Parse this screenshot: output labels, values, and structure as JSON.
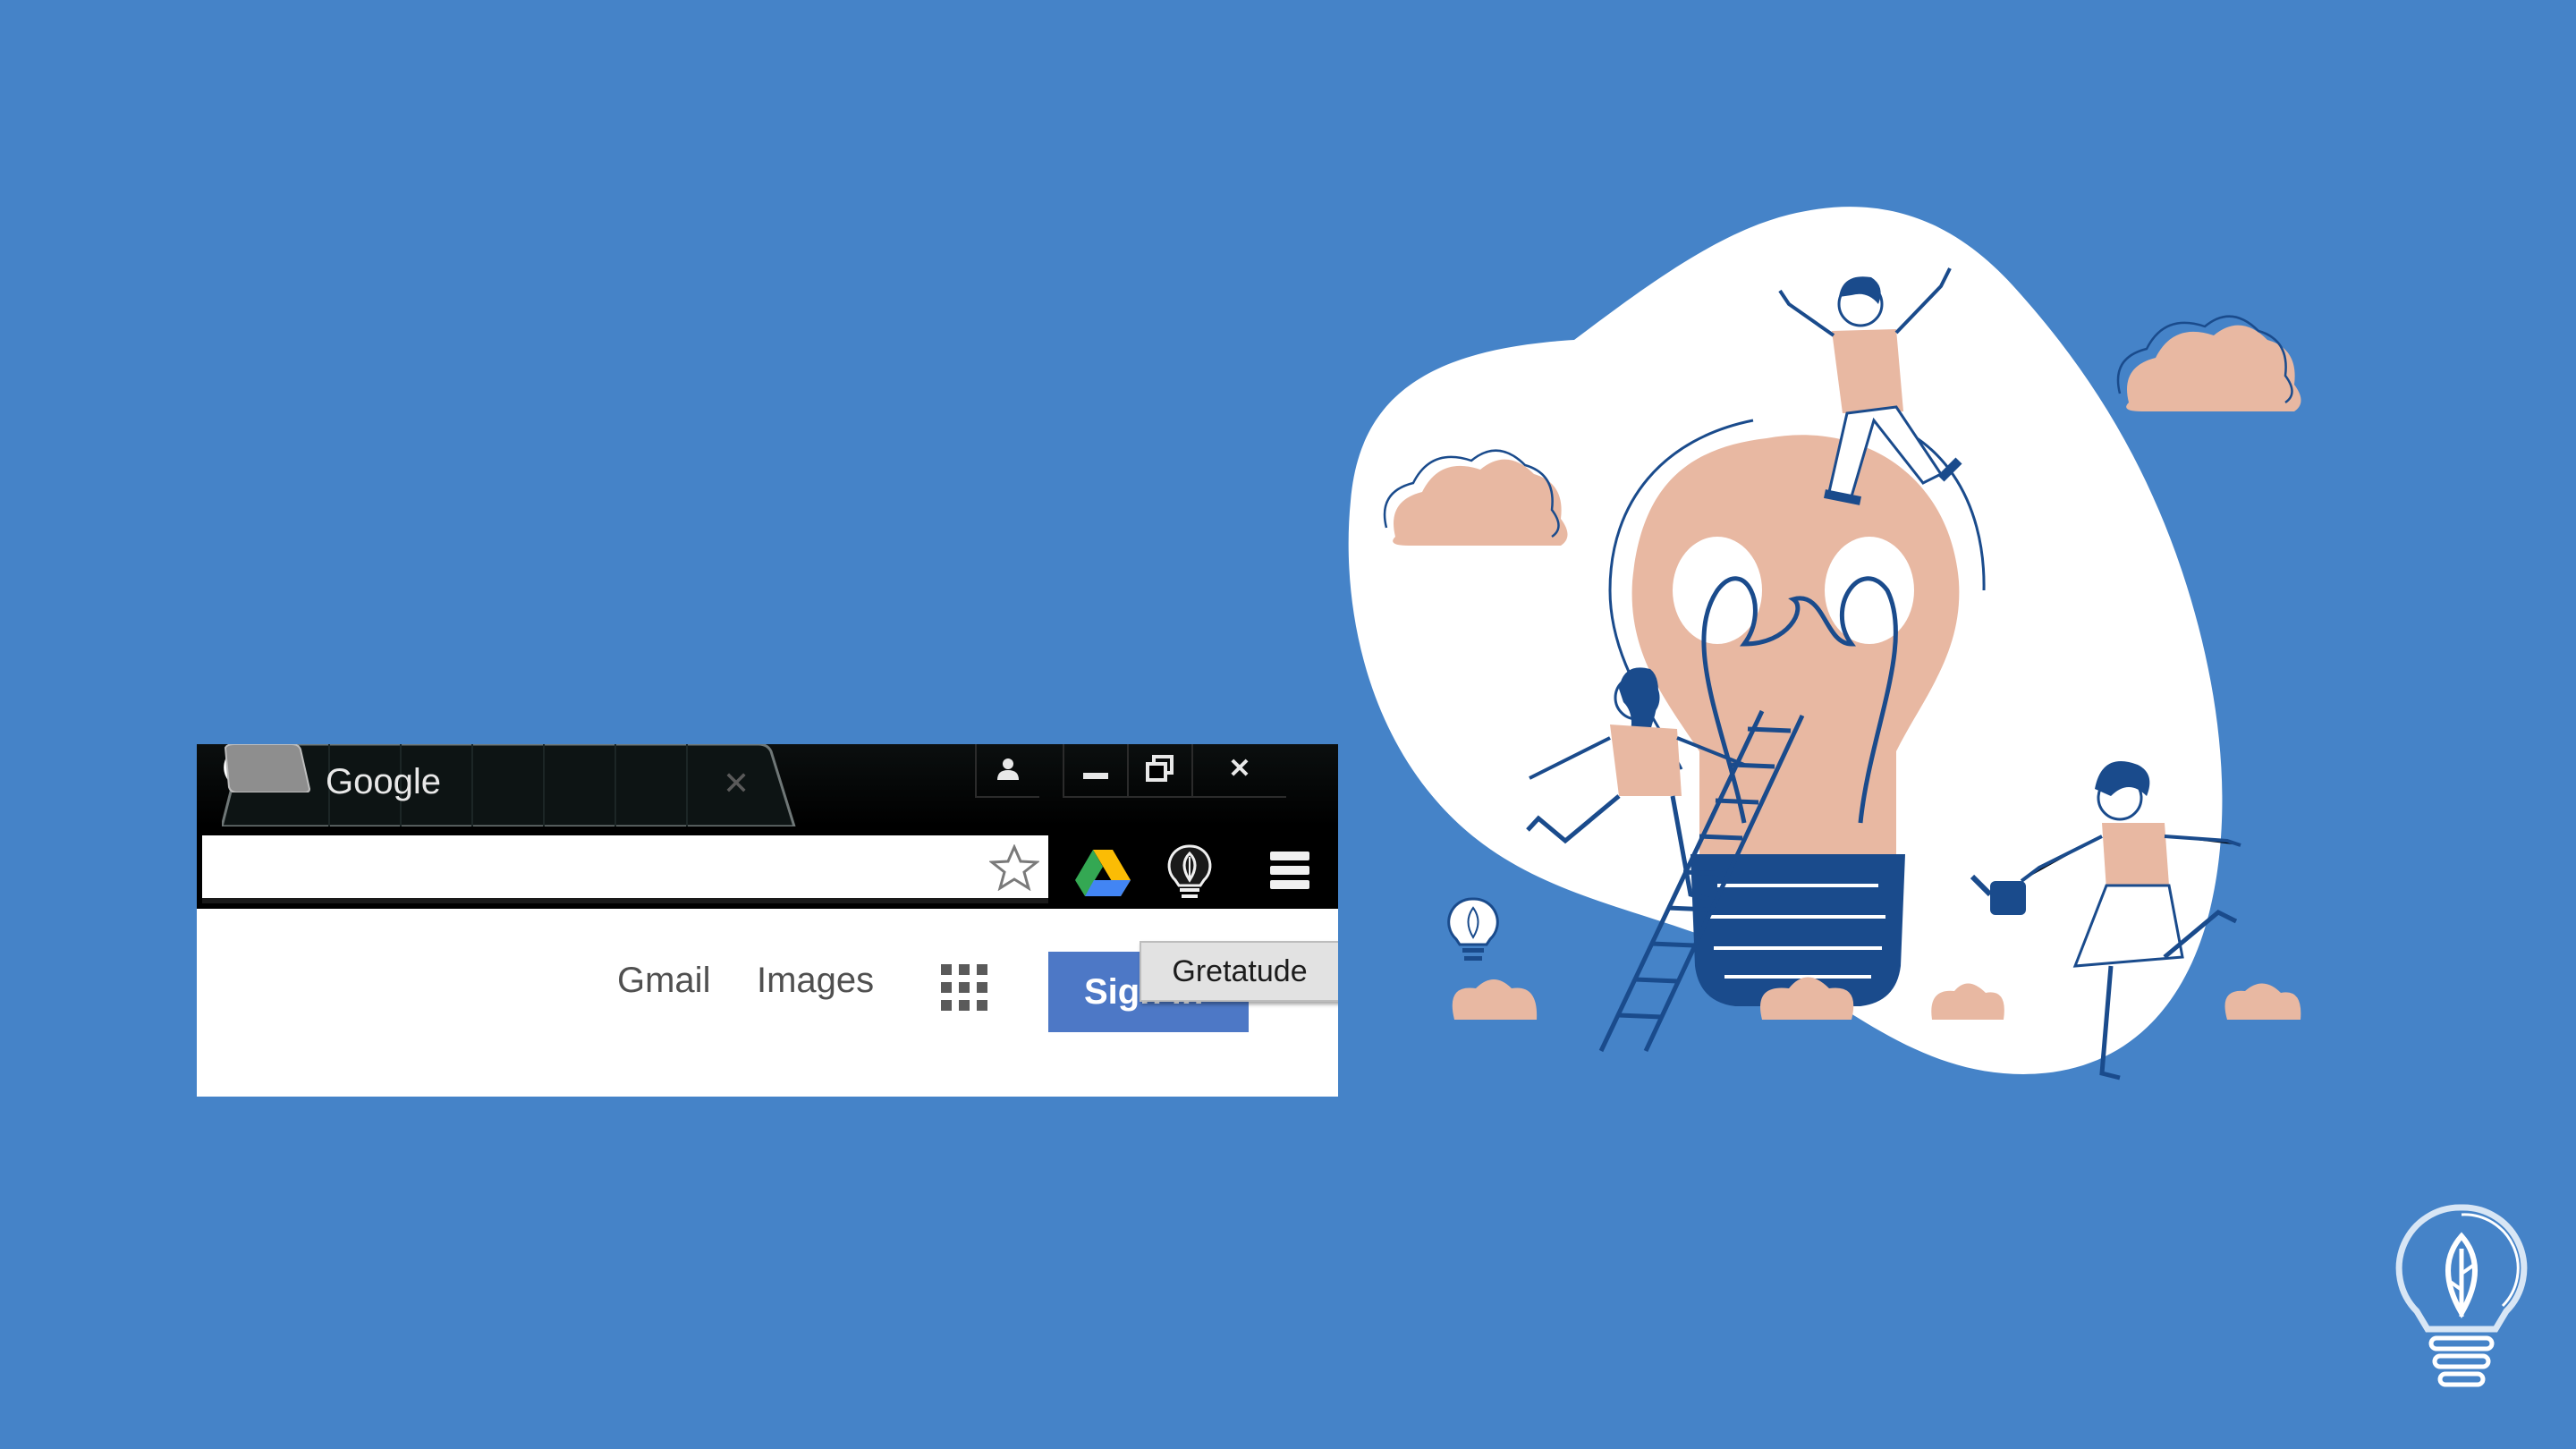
{
  "browser": {
    "tab": {
      "title": "Google"
    },
    "window_controls": {
      "close_glyph": "✕"
    },
    "toolbar": {
      "star_icon": "star-icon",
      "drive_icon": "google-drive-icon",
      "extension_icon": "lightbulb-leaf-icon",
      "menu_icon": "hamburger-menu-icon"
    },
    "page": {
      "links": [
        "Gmail",
        "Images"
      ],
      "apps_icon": "apps-grid-icon",
      "signin_label": "Sign in"
    },
    "tooltip": "Gretatude"
  },
  "colors": {
    "background": "#4583c8",
    "blob": "#ffffff",
    "peach": "#e8b8a2",
    "navy": "#1a4b8c"
  }
}
